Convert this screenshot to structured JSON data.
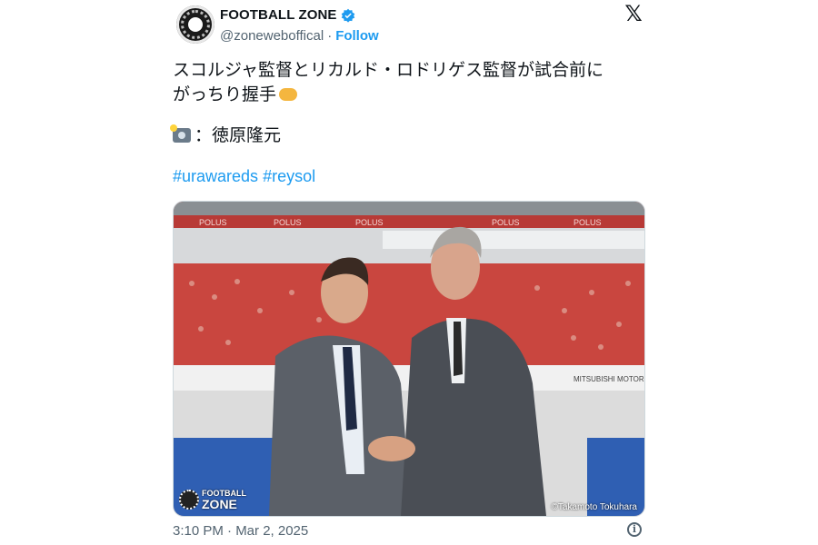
{
  "account": {
    "display_name": "FOOTBALL ZONE",
    "handle": "@zoneweboffical",
    "follow_label": "Follow",
    "separator": "·",
    "verified": true,
    "avatar_icon": "football-zone-logo",
    "brand_icon": "x-logo-icon",
    "x_glyph": "𝕏"
  },
  "tweet": {
    "line1": "スコルジャ監督とリカルド・ロドリゲス監督が試合前に",
    "line2": "がっちり握手",
    "line2_emoji": "handshake-emoji",
    "credit_emoji": "camera-flash-emoji",
    "credit_text": "：徳原隆元",
    "hashtags": [
      "#urawareds",
      "#reysol"
    ]
  },
  "media": {
    "description_icon": "photo-two-coaches-handshake",
    "stadium_banner": "POLUS",
    "sponsor_board": "MITSUBISHI MOTORS",
    "logo_small": "FOOTBALL",
    "logo_big": "ZONE",
    "photo_credit": "©Takamoto Tokuhara"
  },
  "footer": {
    "timestamp": "3:10 PM · Mar 2, 2025",
    "info_glyph": "i",
    "info_icon": "info-icon"
  },
  "colors": {
    "accent": "#1d9bf0",
    "text": "#0f1419",
    "secondary": "#536471",
    "crowd_red": "#c9463f"
  }
}
